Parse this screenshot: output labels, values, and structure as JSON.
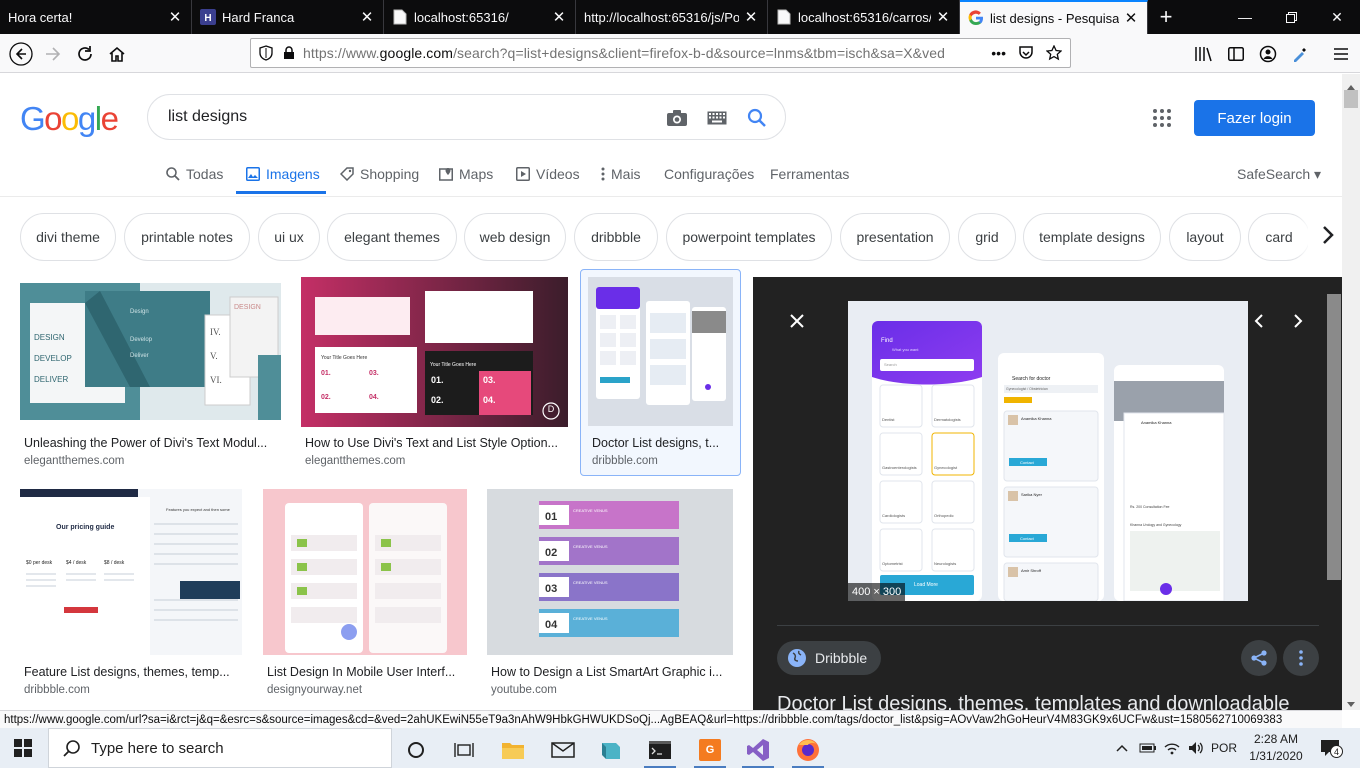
{
  "browser": {
    "tabs": [
      {
        "title": "Hora certa!",
        "active": false
      },
      {
        "title": "Hard Franca",
        "active": false
      },
      {
        "title": "localhost:65316/",
        "active": false
      },
      {
        "title": "http://localhost:65316/js/Pop",
        "active": false
      },
      {
        "title": "localhost:65316/carros/p",
        "active": false
      },
      {
        "title": "list designs - Pesquisa Go",
        "active": true
      }
    ],
    "url_prefix": "https://www.",
    "url_domain": "google.com",
    "url_rest": "/search?q=list+designs&client=firefox-b-d&source=lnms&tbm=isch&sa=X&ved",
    "url_more": "•••"
  },
  "google": {
    "logo": [
      "G",
      "o",
      "o",
      "g",
      "l",
      "e"
    ],
    "query": "list designs",
    "login_label": "Fazer login",
    "tabs": [
      {
        "label": "Todas",
        "icon": "search-icon"
      },
      {
        "label": "Imagens",
        "icon": "image-icon"
      },
      {
        "label": "Shopping",
        "icon": "tag-icon"
      },
      {
        "label": "Maps",
        "icon": "map-icon"
      },
      {
        "label": "Vídeos",
        "icon": "video-icon"
      },
      {
        "label": "Mais",
        "icon": "more-vert-icon"
      },
      {
        "label": "Configurações"
      },
      {
        "label": "Ferramentas"
      }
    ],
    "safesearch": "SafeSearch ▾",
    "chips": [
      "divi theme",
      "printable notes",
      "ui ux",
      "elegant themes",
      "web design",
      "dribbble",
      "powerpoint templates",
      "presentation",
      "grid",
      "template designs",
      "layout",
      "card"
    ]
  },
  "results": [
    {
      "title": "Unleashing the Power of Divi's Text Modul...",
      "source": "elegantthemes.com"
    },
    {
      "title": "How to Use Divi's Text and List Style Option...",
      "source": "elegantthemes.com"
    },
    {
      "title": "Doctor List designs, t...",
      "source": "dribbble.com"
    },
    {
      "title": "Feature List designs, themes, temp...",
      "source": "dribbble.com"
    },
    {
      "title": "List Design In Mobile User Interf...",
      "source": "designyourway.net"
    },
    {
      "title": "How to Design a List SmartArt Graphic i...",
      "source": "youtube.com"
    }
  ],
  "thumb_text": {
    "divi": [
      "DESIGN",
      "DEVELOP",
      "DELIVER",
      "Design",
      "Develop",
      "Deliver",
      "IV.",
      "V.",
      "VI.",
      "DESIGN"
    ],
    "title_here": [
      "Your Title Goes Here",
      "Your Title Goes Here",
      "01.",
      "02.",
      "03.",
      "04.",
      "01.",
      "02.",
      "03.",
      "04."
    ],
    "pricing": [
      "Our pricing guide",
      "$0 per desk",
      "$4 / desk",
      "$8 / desk",
      "Features you expect and then some"
    ],
    "smartart": [
      "01",
      "02",
      "03",
      "04",
      "CREATIVE VENUS"
    ]
  },
  "preview": {
    "dims": "400 × 300",
    "source": "Dribbble",
    "title": "Doctor List designs, themes, templates and downloadable",
    "app": {
      "find": "Find",
      "find_sub": "What you want",
      "search_ph": "Search",
      "search_doctor": "Search for doctor",
      "gyn": "Gynecologist / Obstetrician",
      "categories": [
        "Dentist",
        "Dermatologists",
        "Gastroenterologists",
        "Gynecologist",
        "Cardiologists",
        "Orthopedic",
        "Optometrist",
        "Neurologists"
      ],
      "doctors": [
        "Anamika Khanna",
        "Sarika Nyer",
        "Amir Shroff"
      ],
      "contact": "Contact",
      "load_more": "Load More",
      "profile_name": "Anamika Khanna",
      "fee": "Rs. 200 Consultation Fee",
      "clinic": "Khanna Urology and Gynecology"
    }
  },
  "status_url": "https://www.google.com/url?sa=i&rct=j&q=&esrc=s&source=images&cd=&ved=2ahUKEwiN55eT9a3nAhW9HbkGHWUKDSoQj...AgBEAQ&url=https://dribbble.com/tags/doctor_list&psig=AOvVaw2hGoHeurV4M83GK9x6UCFw&ust=1580562710069383",
  "taskbar": {
    "search_placeholder": "Type here to search",
    "lang": "POR",
    "time": "2:28 AM",
    "date": "1/31/2020",
    "notif_count": "4"
  },
  "colors": {
    "accent": "#1a73e8",
    "firefox_active_tab": "#0a84ff",
    "taskbar": "#e8eef5"
  }
}
